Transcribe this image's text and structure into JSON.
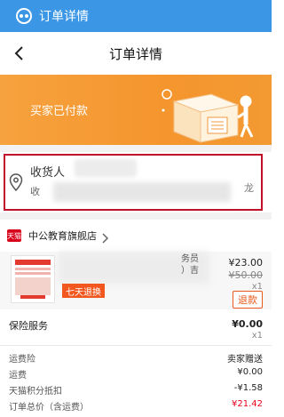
{
  "topbar": {
    "title": "订单详情",
    "logo_icon": "app-logo-icon"
  },
  "navbar": {
    "title": "订单详情",
    "back_icon": "chevron-left-icon"
  },
  "banner": {
    "status_text": "买家已付款",
    "illustration": "box-with-person-illustration"
  },
  "address": {
    "receiver_label": "收货人",
    "line_fragment": "收",
    "tail_fragment": "龙",
    "pin_icon": "location-pin-icon"
  },
  "store": {
    "badge_text": "天猫",
    "name": "中公教育旗舰店"
  },
  "product": {
    "title_fragment_1": "务员",
    "title_fragment_2": "）吉",
    "return_tag": "七天退换",
    "price": "¥23.00",
    "original_price": "¥50.00",
    "quantity": "x1",
    "refund_button": "退款"
  },
  "insurance": {
    "label": "保险服务",
    "value": "¥0.00",
    "quantity": "x1"
  },
  "summary": {
    "rows": [
      {
        "label": "运费险",
        "value": "卖家赠送"
      },
      {
        "label": "运费",
        "value": "¥0.00"
      },
      {
        "label": "天猫积分抵扣",
        "value": "-¥1.58"
      },
      {
        "label": "订单总价（含运费）",
        "value": "¥21.42"
      }
    ]
  },
  "colors": {
    "topbar": "#3b97e6",
    "banner": "#f5952e",
    "highlight_frame": "#c0102a",
    "price_red": "#e8001c"
  }
}
